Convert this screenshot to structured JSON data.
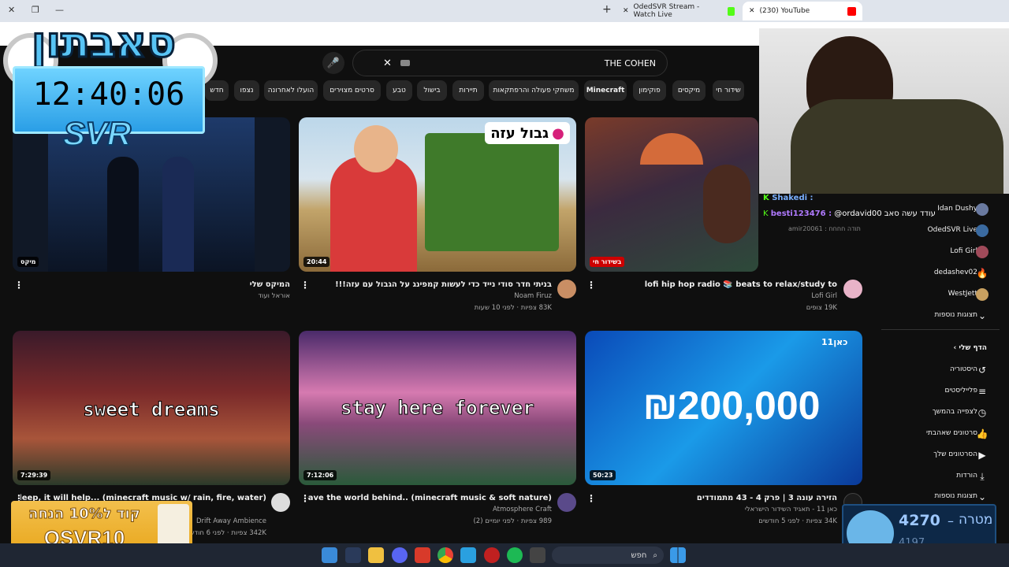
{
  "browser": {
    "tabs": [
      {
        "title": "OdedSVR Stream - Watch Live",
        "active": false
      },
      {
        "title": "(230) YouTube",
        "active": true
      }
    ]
  },
  "youtube": {
    "search": {
      "value": "THE COHEN"
    },
    "chips": [
      "שידור חי",
      "מיקסים",
      "פוקימון",
      "Minecraft",
      "משחקי פעולה והרפתקאות",
      "תיירות",
      "בישול",
      "טבע",
      "סרטים מצוירים",
      "הועלו לאחרונה",
      "נצפו",
      "חדש"
    ],
    "videos": [
      {
        "title": "lofi hip hop radio 📚 beats to relax/study to",
        "channel": "Lofi Girl",
        "meta": "19K צופים",
        "badge": "בשידור חי"
      },
      {
        "title": "בניתי חדר סודי נייד כדי לעשות קמפינג על הגבול עם עזה!!!",
        "channel": "Noam Firuz",
        "meta": "83K צפיות · לפני 10 שעות",
        "duration": "20:44",
        "thumb_text": "גבול עזה"
      },
      {
        "title": "המיקס שלי",
        "channel": "אוראל ועוד",
        "meta": "",
        "badge": "מיקס"
      },
      {
        "title": "הזירה עונה 3 | פרק 4 - 43 מתמודדים",
        "channel": "כאן 11 - תאגיד השידור הישראלי",
        "meta": "34K צפיות · לפני 5 חודשים",
        "duration": "50:23",
        "thumb_text": "₪200,000"
      },
      {
        "title": "leave the world behind.. (minecraft music & soft nature)",
        "channel": "Atmosphere Craft",
        "meta": "989 צפיות · לפני יומיים (2)",
        "duration": "7:12:06",
        "thumb_text": "stay here forever"
      },
      {
        "title": "you need sleep, it will help... (minecraft music w/ rain, fire, water)",
        "channel": "Drift Away Ambience",
        "meta": "342K צפיות · לפני 6 חודשים",
        "duration": "7:29:39",
        "thumb_text": "sweet dreams"
      }
    ],
    "subscriptions": [
      "Idan Dushy",
      "OdedSVR Live",
      "Lofi Girl",
      "dedashev02",
      "WestJett"
    ],
    "show_more": "תצוגות נוספות",
    "you_header": "הדף שלי",
    "you_items": [
      "היסטוריה",
      "פלייליסטים",
      "לצפייה בהמשך",
      "סרטונים שאהבתי",
      "הסרטונים שלך",
      "הורדות",
      "תצוגות נוספות"
    ]
  },
  "overlay": {
    "logo": "סאבתון",
    "clock": "12:40:06",
    "svr": "SVR",
    "chat": [
      {
        "user": "Shakedi :",
        "msg": ""
      },
      {
        "user": "besti123476 :",
        "msg": "@ordavid00 עודד עשה סאב"
      },
      {
        "user": "amir20061 :",
        "msg": "תודה חחחח"
      }
    ],
    "promo": {
      "line1": "קוד ל10% הנחה",
      "line2": "OSVR10"
    },
    "goal": {
      "label": "מטרה",
      "value": "4270",
      "current": "4197"
    }
  },
  "taskbar": {
    "search": "חפש"
  }
}
